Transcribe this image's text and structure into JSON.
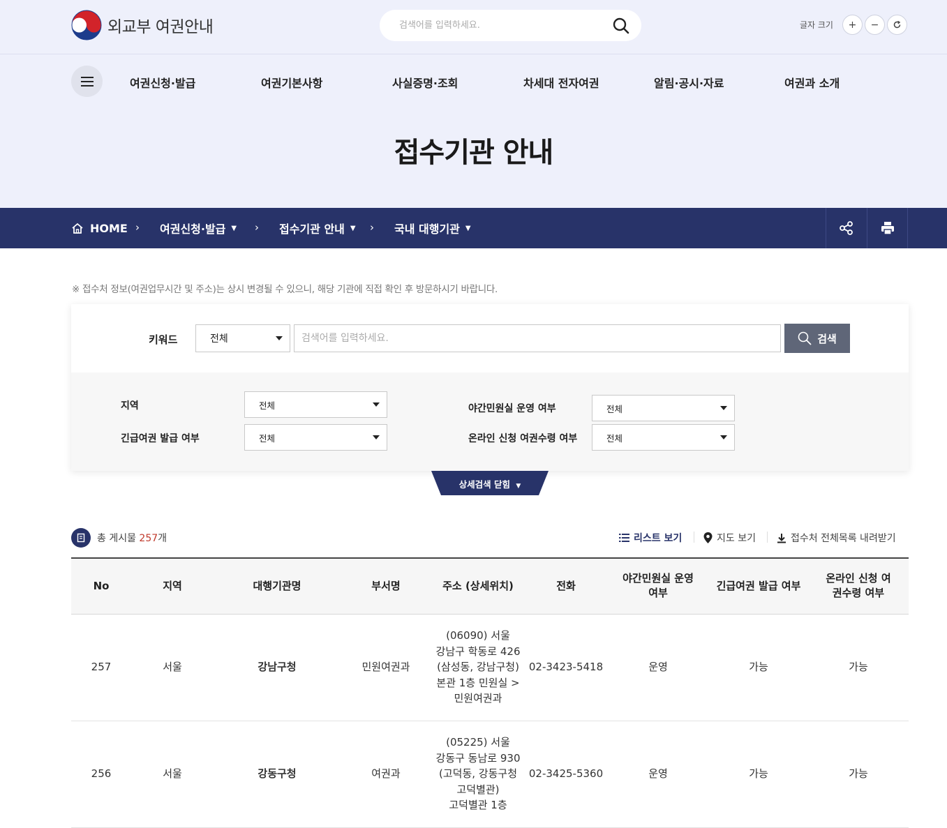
{
  "brand": {
    "logo_text": "외교부 여권안내"
  },
  "top_search": {
    "placeholder": "검색어를 입력하세요."
  },
  "font_size": {
    "label": "글자 크기",
    "plus": "+",
    "minus": "−"
  },
  "gnb": {
    "items": [
      "여권신청·발급",
      "여권기본사항",
      "사실증명·조회",
      "차세대 전자여권",
      "알림·공시·자료",
      "여권과 소개"
    ]
  },
  "page_title": "접수기관 안내",
  "breadcrumb": {
    "home": "HOME",
    "items": [
      "여권신청·발급",
      "접수기관 안내",
      "국내 대행기관"
    ]
  },
  "notice": "※ 접수처 정보(여권업무시간 및 주소)는 상시 변경될 수 있으니, 해당 기관에 직접 확인 후 방문하시기 바랍니다.",
  "search": {
    "keyword_label": "키워드",
    "keyword_select": "전체",
    "keyword_placeholder": "검색어를 입력하세요.",
    "button": "검색",
    "filters": [
      {
        "label": "지역",
        "value": "전체"
      },
      {
        "label": "야간민원실 운영 여부",
        "value": "전체"
      },
      {
        "label": "긴급여권 발급 여부",
        "value": "전체"
      },
      {
        "label": "온라인 신청 여권수령 여부",
        "value": "전체"
      }
    ],
    "toggle_label": "상세검색 닫힘"
  },
  "list_info": {
    "prefix": "총 게시물 ",
    "count": "257",
    "suffix": "개"
  },
  "view_options": {
    "list_view": "리스트 보기",
    "map_view": "지도 보기",
    "download": "접수처 전체목록 내려받기"
  },
  "table": {
    "headers": [
      "No",
      "지역",
      "대행기관명",
      "부서명",
      "주소 (상세위치)",
      "전화",
      "야간민원실 운영 여부",
      "긴급여권 발급 여부",
      "온라인 신청 여권수령 여부"
    ],
    "rows": [
      {
        "no": "257",
        "region": "서울",
        "org": "강남구청",
        "dept": "민원여권과",
        "address_lines": [
          "(06090) 서울",
          "강남구 학동로 426",
          "(삼성동, 강남구청)",
          "본관 1층 민원실 >",
          "민원여권과"
        ],
        "phone": "02-3423-5418",
        "night": "운영",
        "emergency": "가능",
        "online": "가능"
      },
      {
        "no": "256",
        "region": "서울",
        "org": "강동구청",
        "dept": "여권과",
        "address_lines": [
          "(05225) 서울",
          "강동구 동남로 930",
          "(고덕동, 강동구청",
          "고덕별관)",
          "고덕별관 1층"
        ],
        "phone": "02-3425-5360",
        "night": "운영",
        "emergency": "가능",
        "online": "가능"
      }
    ]
  },
  "colors": {
    "header_bg": "#eef0fb",
    "nav_bar": "#283369",
    "search_button": "#5f6678",
    "count_highlight": "#c0392b"
  }
}
